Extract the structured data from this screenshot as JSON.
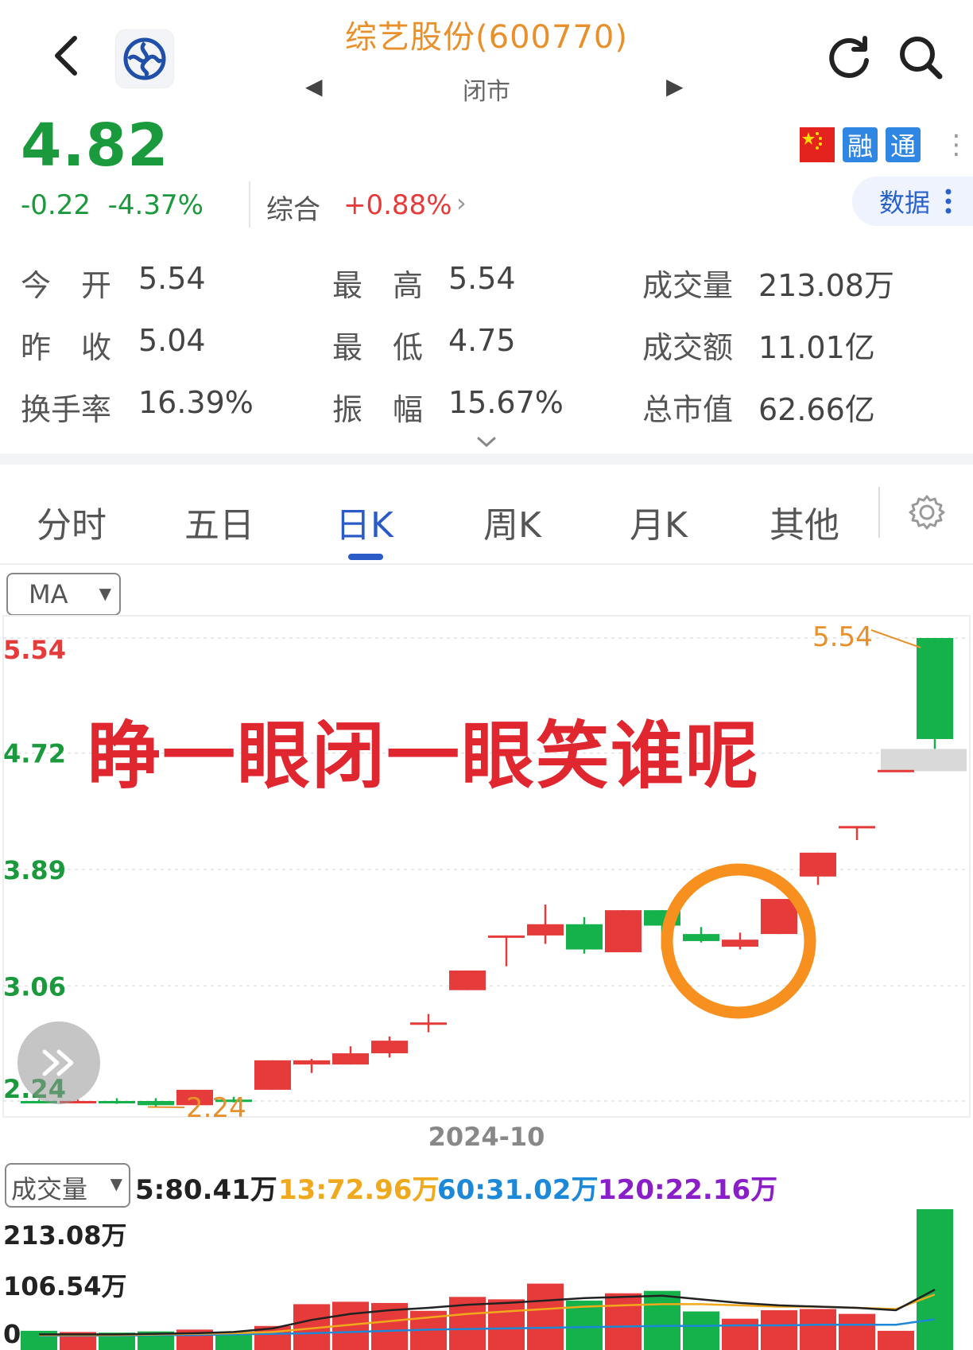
{
  "header": {
    "title": "综艺股份(600770)",
    "status": "闭市",
    "prev_glyph": "◀",
    "next_glyph": "▶",
    "icons": [
      "back-icon",
      "company-logo",
      "refresh-icon",
      "search-icon"
    ]
  },
  "quote": {
    "price": "4.82",
    "change": "-0.22",
    "change_pct": "-4.37%",
    "index_label": "综合",
    "index_change": "+0.88%",
    "index_arrow": "›",
    "badges": [
      "融",
      "通"
    ],
    "data_button": "数据",
    "colors": {
      "down": "#1a9a3c",
      "up": "#e63b3b"
    }
  },
  "stats": [
    {
      "label": "今　开",
      "value": "5.54"
    },
    {
      "label": "最　高",
      "value": "5.54"
    },
    {
      "label": "成交量",
      "value": "213.08万"
    },
    {
      "label": "昨　收",
      "value": "5.04"
    },
    {
      "label": "最　低",
      "value": "4.75"
    },
    {
      "label": "成交额",
      "value": "11.01亿"
    },
    {
      "label": "换手率",
      "value": "16.39%"
    },
    {
      "label": "振　幅",
      "value": "15.67%"
    },
    {
      "label": "总市值",
      "value": "62.66亿"
    }
  ],
  "tabs": [
    {
      "label": "分时"
    },
    {
      "label": "五日"
    },
    {
      "label": "日K"
    },
    {
      "label": "周K"
    },
    {
      "label": "月K"
    },
    {
      "label": "其他"
    }
  ],
  "active_tab": "日K",
  "indicator": {
    "selected": "MA"
  },
  "volume": {
    "selected": "成交量",
    "ma5": "5:80.41万",
    "ma13": "13:72.96万",
    "ma60": "60:31.02万",
    "ma120": "120:22.16万",
    "axis": [
      "213.08万",
      "106.54万",
      "0"
    ]
  },
  "annotation": "睁一眼闭一眼笑谁呢",
  "chart_data": {
    "type": "candlestick",
    "y_ticks": [
      "5.54",
      "4.72",
      "3.89",
      "3.06",
      "2.24"
    ],
    "ylim": [
      2.24,
      5.54
    ],
    "high_label": "5.54",
    "low_label": "2.24",
    "x_label": "2024-10",
    "candles": [
      {
        "o": 2.24,
        "c": 2.24,
        "h": 2.25,
        "l": 2.23,
        "dir": "down",
        "vol": 12
      },
      {
        "o": 2.24,
        "c": 2.24,
        "h": 2.25,
        "l": 2.23,
        "dir": "up",
        "vol": 10
      },
      {
        "o": 2.24,
        "c": 2.24,
        "h": 2.26,
        "l": 2.22,
        "dir": "down",
        "vol": 9
      },
      {
        "o": 2.24,
        "c": 2.21,
        "h": 2.26,
        "l": 2.2,
        "dir": "down",
        "vol": 11
      },
      {
        "o": 2.21,
        "c": 2.32,
        "h": 2.32,
        "l": 2.21,
        "dir": "up",
        "vol": 14
      },
      {
        "o": 2.24,
        "c": 2.25,
        "h": 2.27,
        "l": 2.23,
        "dir": "down",
        "vol": 9
      },
      {
        "o": 2.32,
        "c": 2.53,
        "h": 2.53,
        "l": 2.32,
        "dir": "up",
        "vol": 20
      },
      {
        "o": 2.5,
        "c": 2.53,
        "h": 2.54,
        "l": 2.44,
        "dir": "up",
        "vol": 56
      },
      {
        "o": 2.5,
        "c": 2.58,
        "h": 2.63,
        "l": 2.5,
        "dir": "up",
        "vol": 60
      },
      {
        "o": 2.58,
        "c": 2.67,
        "h": 2.7,
        "l": 2.55,
        "dir": "up",
        "vol": 58
      },
      {
        "o": 2.8,
        "c": 2.8,
        "h": 2.86,
        "l": 2.73,
        "dir": "up",
        "vol": 45
      },
      {
        "o": 3.03,
        "c": 3.17,
        "h": 3.17,
        "l": 3.03,
        "dir": "up",
        "vol": 68
      },
      {
        "o": 3.42,
        "c": 3.42,
        "h": 3.42,
        "l": 3.2,
        "dir": "up",
        "vol": 64
      },
      {
        "o": 3.42,
        "c": 3.5,
        "h": 3.64,
        "l": 3.36,
        "dir": "up",
        "vol": 90
      },
      {
        "o": 3.5,
        "c": 3.32,
        "h": 3.55,
        "l": 3.29,
        "dir": "down",
        "vol": 62
      },
      {
        "o": 3.3,
        "c": 3.6,
        "h": 3.6,
        "l": 3.3,
        "dir": "up",
        "vol": 74
      },
      {
        "o": 3.6,
        "c": 3.49,
        "h": 3.6,
        "l": 3.32,
        "dir": "down",
        "vol": 78
      },
      {
        "o": 3.43,
        "c": 3.38,
        "h": 3.48,
        "l": 3.37,
        "dir": "down",
        "vol": 44
      },
      {
        "o": 3.34,
        "c": 3.39,
        "h": 3.44,
        "l": 3.32,
        "dir": "up",
        "vol": 32
      },
      {
        "o": 3.43,
        "c": 3.68,
        "h": 3.68,
        "l": 3.43,
        "dir": "up",
        "vol": 46
      },
      {
        "o": 3.84,
        "c": 4.01,
        "h": 4.01,
        "l": 3.78,
        "dir": "up",
        "vol": 48
      },
      {
        "o": 4.2,
        "c": 4.2,
        "h": 4.2,
        "l": 4.1,
        "dir": "up",
        "vol": 40
      },
      {
        "o": 4.6,
        "c": 4.6,
        "h": 4.6,
        "l": 4.6,
        "dir": "up",
        "vol": 12
      },
      {
        "o": 5.54,
        "c": 4.82,
        "h": 5.54,
        "l": 4.75,
        "dir": "down",
        "vol": 213
      }
    ],
    "prev_close_band": 4.67,
    "highlight_candles": [
      17,
      18,
      19
    ],
    "vol_ma_black": [
      6,
      6,
      6,
      7,
      8,
      10,
      16,
      30,
      40,
      46,
      50,
      55,
      58,
      62,
      66,
      68,
      70,
      64,
      58,
      54,
      52,
      50,
      46,
      80
    ],
    "vol_ma_orange": [
      5,
      5,
      5,
      6,
      7,
      8,
      10,
      16,
      22,
      28,
      34,
      40,
      44,
      48,
      52,
      54,
      56,
      56,
      54,
      52,
      52,
      50,
      48,
      72
    ],
    "vol_ma_blue": [
      4,
      4,
      4,
      5,
      5,
      6,
      7,
      8,
      10,
      12,
      14,
      15,
      16,
      17,
      18,
      19,
      20,
      20,
      21,
      21,
      22,
      22,
      22,
      31
    ],
    "vol_max": 213
  }
}
